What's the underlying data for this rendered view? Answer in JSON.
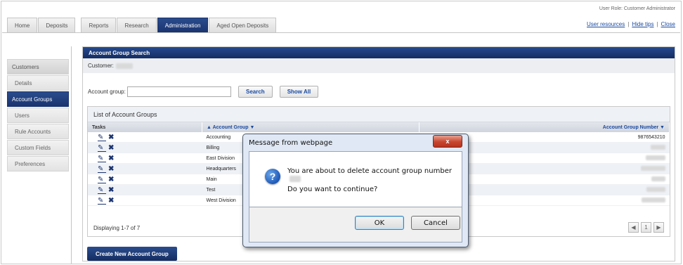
{
  "header": {
    "tabs": [
      {
        "label": "Home"
      },
      {
        "label": "Deposits"
      },
      {
        "label": "Reports"
      },
      {
        "label": "Research"
      },
      {
        "label": "Administration"
      },
      {
        "label": "Aged Open Deposits"
      }
    ],
    "active_tab": "Administration",
    "user_role": "User Role: Customer Administrator",
    "links": {
      "user_resources": "User resources",
      "hide_tips": "Hide tips",
      "close": "Close",
      "separator": "|"
    }
  },
  "sidebar": {
    "items": [
      {
        "label": "Customers",
        "kind": "header"
      },
      {
        "label": "Details",
        "kind": "sub"
      },
      {
        "label": "Account Groups",
        "kind": "active"
      },
      {
        "label": "Users",
        "kind": "sub"
      },
      {
        "label": "Rule Accounts",
        "kind": "sub"
      },
      {
        "label": "Custom Fields",
        "kind": "sub"
      },
      {
        "label": "Preferences",
        "kind": "sub"
      }
    ]
  },
  "main": {
    "panel_title": "Account Group Search",
    "customer_label": "Customer:",
    "account_group_label": "Account group:",
    "search_value": "",
    "search_button": "Search",
    "show_all_button": "Show All",
    "list_title": "List of Account Groups",
    "columns": {
      "tasks": "Tasks",
      "account_group": "▲ Account Group ▼",
      "account_group_number": "Account Group Number ▼"
    },
    "rows": [
      {
        "name": "Accounting",
        "number": "9876543210"
      },
      {
        "name": "Billing",
        "number": ""
      },
      {
        "name": "East Division",
        "number": ""
      },
      {
        "name": "Headquarters",
        "number": ""
      },
      {
        "name": "Main",
        "number": ""
      },
      {
        "name": "Test",
        "number": ""
      },
      {
        "name": "West Division",
        "number": ""
      }
    ],
    "displaying": "Displaying 1-7 of 7",
    "page_number": "1",
    "create_button": "Create New Account Group"
  },
  "dialog": {
    "title": "Message from webpage",
    "close_glyph": "x",
    "message_line1": "You are about to delete account group number",
    "message_line2": "Do you want to continue?",
    "ok_label": "OK",
    "cancel_label": "Cancel"
  },
  "colors": {
    "nav_blue": "#1b3470",
    "link_blue": "#1a4aa0",
    "dialog_bg": "#dfe8f4"
  }
}
